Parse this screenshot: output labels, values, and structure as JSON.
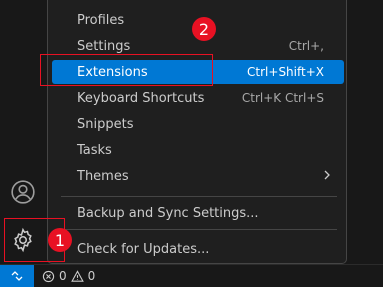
{
  "menu": {
    "items": [
      {
        "label": "Profiles",
        "shortcut": ""
      },
      {
        "label": "Settings",
        "shortcut": "Ctrl+,"
      },
      {
        "label": "Extensions",
        "shortcut": "Ctrl+Shift+X"
      },
      {
        "label": "Keyboard Shortcuts",
        "shortcut": "Ctrl+K Ctrl+S"
      },
      {
        "label": "Snippets",
        "shortcut": ""
      },
      {
        "label": "Tasks",
        "shortcut": ""
      },
      {
        "label": "Themes",
        "shortcut": ""
      },
      {
        "label": "Backup and Sync Settings...",
        "shortcut": ""
      },
      {
        "label": "Check for Updates...",
        "shortcut": ""
      }
    ]
  },
  "status_bar": {
    "errors": "0",
    "warnings": "0"
  },
  "annotations": {
    "step1": "1",
    "step2": "2"
  },
  "colors": {
    "accent": "#0078d4",
    "annotation": "#e81123"
  },
  "icons": {
    "accounts": "account-icon",
    "manage": "gear-icon",
    "remote": "remote-icon",
    "errors": "error-icon",
    "warnings": "warning-icon",
    "submenu": "chevron-right-icon"
  }
}
